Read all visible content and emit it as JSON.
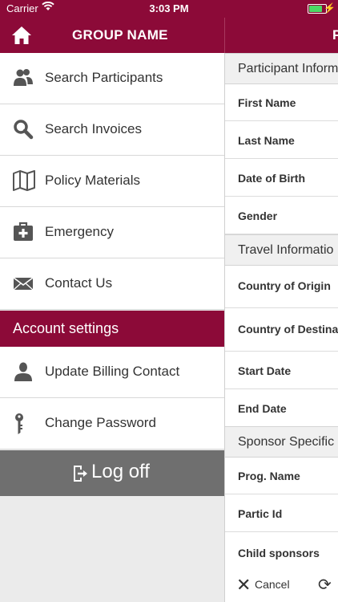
{
  "status": {
    "carrier": "Carrier",
    "time": "3:03 PM",
    "battery_level": 0.9
  },
  "header": {
    "title": "GROUP NAME",
    "right_title": "P"
  },
  "menu": {
    "items": [
      {
        "label": "Search Participants",
        "icon": "people-icon"
      },
      {
        "label": "Search Invoices",
        "icon": "search-icon"
      },
      {
        "label": "Policy Materials",
        "icon": "map-icon"
      },
      {
        "label": "Emergency",
        "icon": "first-aid-kit-icon"
      },
      {
        "label": "Contact Us",
        "icon": "envelope-icon"
      }
    ],
    "section_title": "Account settings",
    "account_items": [
      {
        "label": "Update Billing Contact",
        "icon": "person-icon"
      },
      {
        "label": "Change Password",
        "icon": "key-icon"
      }
    ],
    "logoff_label": "Log off"
  },
  "pane": {
    "sections": [
      {
        "title": "Participant Inform",
        "fields": [
          "First Name",
          "Last Name",
          "Date of Birth",
          "Gender"
        ]
      },
      {
        "title": "Travel Informatio",
        "fields": [
          "Country of Origin",
          "Country of Destina",
          "Start Date",
          "End Date"
        ]
      },
      {
        "title": "Sponsor Specific",
        "fields": [
          "Prog. Name",
          "Partic Id",
          "Child sponsors"
        ]
      }
    ],
    "cancel_label": "Cancel"
  },
  "colors": {
    "brand": "#8c0a38",
    "logoff_bg": "#6f6f6f"
  }
}
